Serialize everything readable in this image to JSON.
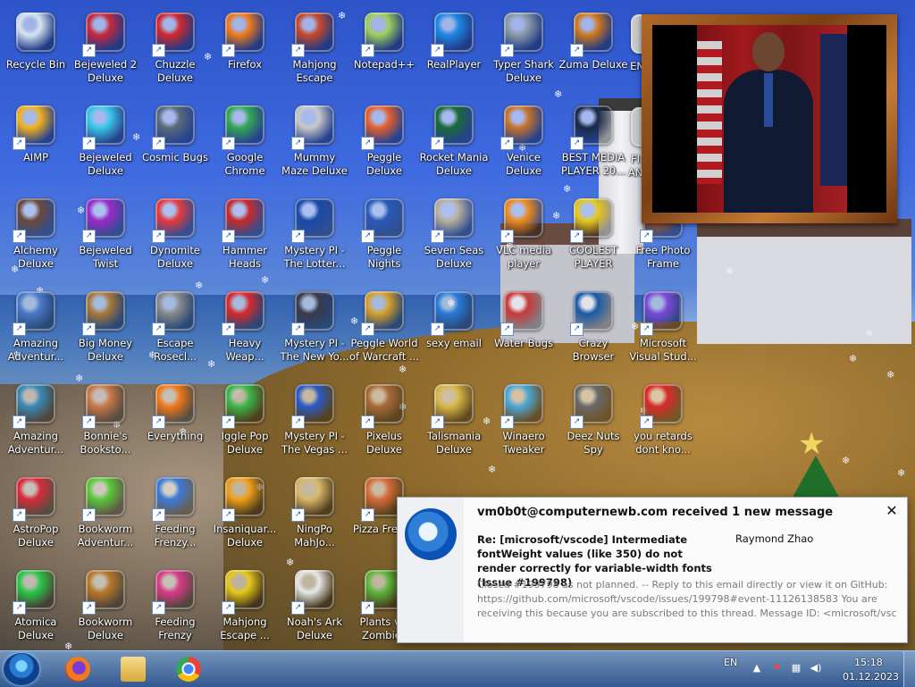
{
  "desktop_icons": [
    {
      "label": "Recycle Bin",
      "icon": "recycle-bin-icon",
      "color": "#d8e4f0",
      "shortcut": false
    },
    {
      "label": "Bejeweled 2 Deluxe",
      "icon": "bejeweled-2-icon",
      "color": "#c8283c",
      "shortcut": true
    },
    {
      "label": "Chuzzle Deluxe",
      "icon": "chuzzle-icon",
      "color": "#d4282a",
      "shortcut": true
    },
    {
      "label": "Firefox",
      "icon": "firefox-icon",
      "color": "#f07a1a",
      "shortcut": true
    },
    {
      "label": "Mahjong Escape Anci...",
      "icon": "mahjong-gate-icon",
      "color": "#c84a2a",
      "shortcut": true
    },
    {
      "label": "Notepad++",
      "icon": "notepad-plus-plus-icon",
      "color": "#9fcf5a",
      "shortcut": true
    },
    {
      "label": "RealPlayer",
      "icon": "realplayer-icon",
      "color": "#1e88e5",
      "shortcut": true
    },
    {
      "label": "Typer Shark Deluxe",
      "icon": "typer-shark-icon",
      "color": "#8a9aa8",
      "shortcut": true
    },
    {
      "label": "Zuma Deluxe",
      "icon": "zuma-icon",
      "color": "#d27a1a",
      "shortcut": true
    },
    {
      "label": "AIMP",
      "icon": "aimp-icon",
      "color": "#f2b21a",
      "shortcut": true
    },
    {
      "label": "Bejeweled Deluxe",
      "icon": "bejeweled-diamond-icon",
      "color": "#3ac8e8",
      "shortcut": true
    },
    {
      "label": "Cosmic Bugs",
      "icon": "cosmic-bugs-icon",
      "color": "#5a6a7a",
      "shortcut": true
    },
    {
      "label": "Google Chrome",
      "icon": "chrome-icon",
      "color": "#34a853",
      "shortcut": true
    },
    {
      "label": "Mummy Maze Deluxe",
      "icon": "mummy-maze-icon",
      "color": "#c8c8c8",
      "shortcut": true
    },
    {
      "label": "Peggle Deluxe",
      "icon": "peggle-icon",
      "color": "#e8602a",
      "shortcut": true
    },
    {
      "label": "Rocket Mania Deluxe",
      "icon": "rocket-mania-icon",
      "color": "#1a6a3a",
      "shortcut": true
    },
    {
      "label": "Venice Deluxe",
      "icon": "venice-icon",
      "color": "#c8742a",
      "shortcut": true
    },
    {
      "label": "BEST MEDIA PLAYER 20...",
      "icon": "xm-play-icon",
      "color": "#1a2a4a",
      "shortcut": true
    },
    {
      "label": "Alchemy Deluxe",
      "icon": "alchemy-wizard-icon",
      "color": "#6a4a3a",
      "shortcut": true
    },
    {
      "label": "Bejeweled Twist",
      "icon": "bejeweled-twist-icon",
      "color": "#9a2ac8",
      "shortcut": true
    },
    {
      "label": "Dynomite Deluxe",
      "icon": "dynomite-egg-icon",
      "color": "#e83a3a",
      "shortcut": true
    },
    {
      "label": "Hammer Heads Deluxe",
      "icon": "hammer-heads-gnome-icon",
      "color": "#c82a2a",
      "shortcut": true
    },
    {
      "label": "Mystery PI - The Lotter...",
      "icon": "mystery-pi-icon",
      "color": "#1a4aa8",
      "shortcut": true
    },
    {
      "label": "Peggle Nights Deluxe",
      "icon": "peggle-nights-icon",
      "color": "#2a5ab8",
      "shortcut": true
    },
    {
      "label": "Seven Seas Deluxe",
      "icon": "seven-seas-skull-icon",
      "color": "#b8b0a0",
      "shortcut": true
    },
    {
      "label": "VLC media player",
      "icon": "vlc-cone-icon",
      "color": "#f08a1a",
      "shortcut": true
    },
    {
      "label": "COOLEST PLAYER",
      "icon": "coolest-player-icon",
      "color": "#e8c81a",
      "shortcut": true
    },
    {
      "label": "Free Photo Frame",
      "icon": "free-photo-frame-icon",
      "color": "#b85a1a",
      "shortcut": true
    },
    {
      "label": "Amazing Adventur...",
      "icon": "amazing-adventures-gem-icon",
      "color": "#4a7ac8",
      "shortcut": true
    },
    {
      "label": "Big Money Deluxe",
      "icon": "big-money-bag-icon",
      "color": "#a87a3a",
      "shortcut": true
    },
    {
      "label": "Escape Rosecl...",
      "icon": "escape-rosecliff-moon-icon",
      "color": "#8a8a8a",
      "shortcut": true
    },
    {
      "label": "Heavy Weap...",
      "icon": "heavy-weapon-radiation-icon",
      "color": "#d82a2a",
      "shortcut": true
    },
    {
      "label": "Mystery PI - The New Yo...",
      "icon": "mystery-pi-newyork-icon",
      "color": "#3a3a4a",
      "shortcut": true
    },
    {
      "label": "Peggle World of Warcraft ...",
      "icon": "peggle-warcraft-icon",
      "color": "#d8a02a",
      "shortcut": true
    },
    {
      "label": "sexy email",
      "icon": "thunderbird-icon",
      "color": "#2a7ad8",
      "shortcut": true
    },
    {
      "label": "Water Bugs",
      "icon": "water-bugs-icon",
      "color": "#c83a3a",
      "shortcut": true
    },
    {
      "label": "Crazy Browser",
      "icon": "crazy-browser-icon",
      "color": "#1a5aa8",
      "shortcut": true
    },
    {
      "label": "Microsoft Visual Stud...",
      "icon": "visual-studio-icon",
      "color": "#7a4ad8",
      "shortcut": true
    },
    {
      "label": "Amazing Adventur...",
      "icon": "amazing-adventures-compass-icon",
      "color": "#3a8ab8",
      "shortcut": true
    },
    {
      "label": "Bonnie's Booksto...",
      "icon": "bonnies-bookstore-icon",
      "color": "#c87a4a",
      "shortcut": true
    },
    {
      "label": "Everything",
      "icon": "everything-search-icon",
      "color": "#f07a1a",
      "shortcut": true
    },
    {
      "label": "Iggle Pop Deluxe",
      "icon": "iggle-pop-icon",
      "color": "#3ab84a",
      "shortcut": true
    },
    {
      "label": "Mystery PI - The Vegas ...",
      "icon": "mystery-pi-vegas-icon",
      "color": "#2a5ac8",
      "shortcut": true
    },
    {
      "label": "Pixelus Deluxe",
      "icon": "pixelus-icon",
      "color": "#a86a3a",
      "shortcut": true
    },
    {
      "label": "Talismania Deluxe",
      "icon": "talismania-icon",
      "color": "#d8b84a",
      "shortcut": true
    },
    {
      "label": "Winaero Tweaker",
      "icon": "winaero-tweaker-icon",
      "color": "#4aa8d8",
      "shortcut": true
    },
    {
      "label": "Deez Nuts Spy",
      "icon": "deez-nuts-spy-icon",
      "color": "#6a6a6a",
      "shortcut": true
    },
    {
      "label": "you retards dont kno...",
      "icon": "red-dragon-icon",
      "color": "#d82a2a",
      "shortcut": true
    },
    {
      "label": "AstroPop Deluxe",
      "icon": "astropop-icon",
      "color": "#d82a3a",
      "shortcut": true
    },
    {
      "label": "Bookworm Adventur...",
      "icon": "bookworm-adventures-icon",
      "color": "#5ac83a",
      "shortcut": true
    },
    {
      "label": "Feeding Frenzy...",
      "icon": "feeding-frenzy-2-icon",
      "color": "#3a7ad8",
      "shortcut": true
    },
    {
      "label": "Insaniquar... Deluxe",
      "icon": "insaniquarium-fish-icon",
      "color": "#f0a01a",
      "shortcut": true
    },
    {
      "label": "NingPo MahJo...",
      "icon": "ningpo-mahjong-icon",
      "color": "#d8b86a",
      "shortcut": true
    },
    {
      "label": "Pizza Frenzy",
      "icon": "pizza-frenzy-icon",
      "color": "#d86a3a",
      "shortcut": true
    },
    {
      "label": "Atomica Deluxe",
      "icon": "atomica-icon",
      "color": "#2ac84a",
      "shortcut": true
    },
    {
      "label": "Bookworm Deluxe",
      "icon": "bookworm-deluxe-icon",
      "color": "#b8782a",
      "shortcut": true
    },
    {
      "label": "Feeding Frenzy Deluxe",
      "icon": "feeding-frenzy-icon",
      "color": "#d83a8a",
      "shortcut": true
    },
    {
      "label": "Mahjong Escape ...",
      "icon": "mahjong-escape-icon",
      "color": "#e8c81a",
      "shortcut": true
    },
    {
      "label": "Noah's Ark Deluxe",
      "icon": "noahs-ark-dove-icon",
      "color": "#e8e8e8",
      "shortcut": true
    },
    {
      "label": "Plants vs. Zombies",
      "icon": "plants-vs-zombies-icon",
      "color": "#5ab83a",
      "shortcut": true
    }
  ],
  "partial_icons": [
    {
      "label": "EN",
      "icon": "partial-icon",
      "color": "#c8c8c8"
    },
    {
      "label": "FI AN",
      "icon": "partial-icon",
      "color": "#c8c8c8"
    }
  ],
  "notification": {
    "title": "vm0b0t@computernewb.com received 1 new message",
    "subject": "Re: [microsoft/vscode] Intermediate fontWeight values (like 350) do not render correctly for variable-width fonts (Issue #199798)",
    "from": "Raymond Zhao",
    "body": "Closed #199798 as not planned. -- Reply to this email directly or view it on GitHub: https://github.com/microsoft/vscode/issues/199798#event-11126138583 You are receiving this because you are subscribed to this thread. Message ID: <microsoft/vsc",
    "close_symbol": "✕"
  },
  "taskbar": {
    "pinned": [
      {
        "name": "firefox",
        "icon": "firefox-icon",
        "color": "#f07a1a"
      },
      {
        "name": "explorer",
        "icon": "folder-icon",
        "color": "#e8c25a"
      },
      {
        "name": "chrome",
        "icon": "chrome-icon",
        "color": "#34a853"
      }
    ],
    "language": "EN",
    "time": "15:18",
    "date": "01.12.2023"
  },
  "colors": {
    "notification_bg": "#fbfbfb",
    "taskbar": "#3a6ab0"
  }
}
